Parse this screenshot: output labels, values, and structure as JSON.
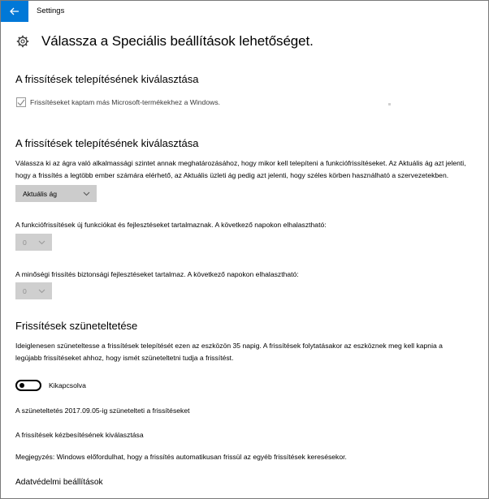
{
  "window": {
    "title": "Settings"
  },
  "page": {
    "title": "Válassza a Speciális beállítások lehetőséget."
  },
  "section1": {
    "heading": "A frissítések telepítésének kiválasztása",
    "checkbox_label": "Frissítéseket kaptam más Microsoft-termékekhez a Windows.",
    "checkbox_checked": true
  },
  "section2": {
    "heading": "A frissítések telepítésének kiválasztása",
    "description_line1": "Válassza ki az ágra való alkalmassági szintet annak meghatározásához, hogy mikor kell telepíteni a funkciófrissítéseket. Az Aktuális ág azt jelenti,",
    "description_line2": "hogy a frissítés a legtöbb ember számára elérhető, az Aktuális üzleti ág pedig azt jelenti, hogy széles körben használható a szervezetekben.",
    "branch_select_value": "Aktuális ág",
    "feature_defer_text": "A funkciófrissítések új funkciókat és fejlesztéseket tartalmaznak. A következő napokon elhalasztható:",
    "feature_defer_value": "0",
    "quality_defer_text": "A minőségi frissítés biztonsági fejlesztéseket tartalmaz. A következő napokon elhalasztható:",
    "quality_defer_value": "0"
  },
  "section3": {
    "heading": "Frissítések szüneteltetése",
    "description_line1": "Ideiglenesen szüneteltesse a frissítések telepítését ezen az eszközön 35 napig. A frissítések folytatásakor az eszköznek meg kell kapnia a",
    "description_line2": "legújabb frissítéseket ahhoz, hogy ismét szüneteltetni tudja a frissítést.",
    "toggle_label": "Kikapcsolva",
    "toggle_on": false,
    "pause_until_text": "A szüneteltetés 2017.09.05-ig szünetelteti a frissítéseket",
    "delivery_link": "A frissítések kézbesítésének kiválasztása",
    "note_text": "Megjegyzés: Windows előfordulhat, hogy a frissítés automatikusan frissül az egyéb frissítések keresésekor.",
    "privacy_link": "Adatvédelmi beállítások"
  },
  "colors": {
    "accent": "#0078d7",
    "dropdown_bg": "#cccccc"
  },
  "icons": {
    "back": "back-arrow-icon",
    "settings": "gear-icon",
    "checkbox": "checkmark-icon",
    "chevron": "chevron-down-icon"
  }
}
